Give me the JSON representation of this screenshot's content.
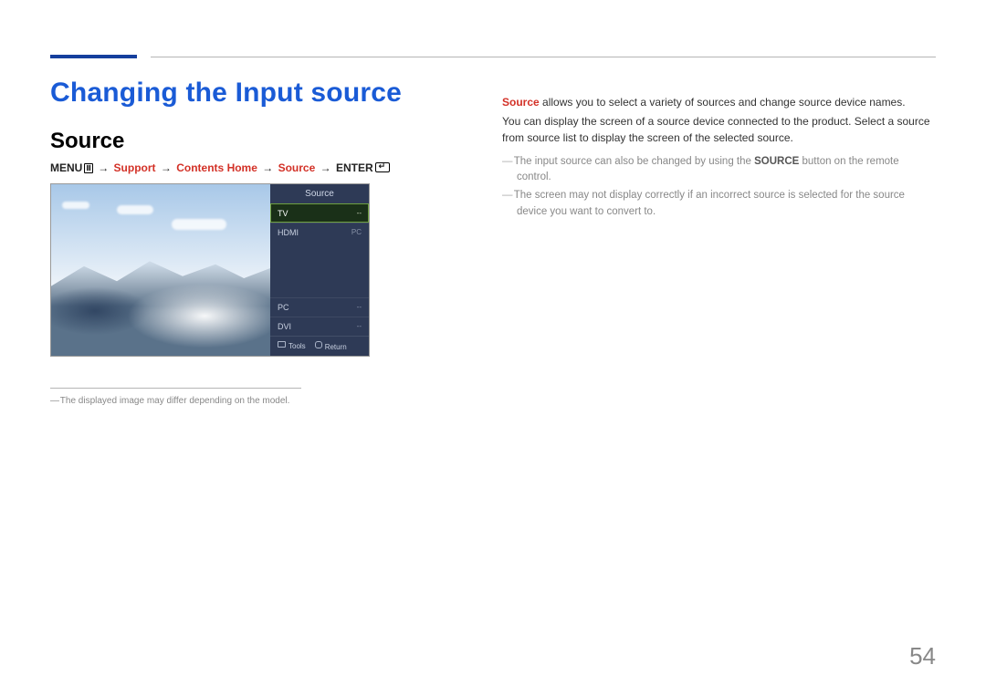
{
  "page_number": "54",
  "header": {
    "title": "Changing the Input source",
    "subtitle": "Source"
  },
  "nav_path": {
    "menu": "MENU",
    "step1": "Support",
    "step2": "Contents Home",
    "step3": "Source",
    "enter": "ENTER"
  },
  "osd": {
    "title": "Source",
    "items": [
      {
        "label": "TV",
        "value": "--",
        "selected": true
      },
      {
        "label": "HDMI",
        "value": "PC",
        "selected": false
      },
      {
        "label": "PC",
        "value": "--",
        "selected": false
      },
      {
        "label": "DVI",
        "value": "--",
        "selected": false
      }
    ],
    "bottom": {
      "tools": "Tools",
      "return": "Return"
    }
  },
  "left_note": "The displayed image may differ depending on the model.",
  "body": {
    "p1_lead": "Source",
    "p1_rest": " allows you to select a variety of sources and change source device names.",
    "p2": "You can display the screen of a source device connected to the product. Select a source from source list to display the screen of the selected source.",
    "bullets": [
      {
        "pre": "The input source can also be changed by using the ",
        "bold": "SOURCE",
        "post": " button on the remote control."
      },
      {
        "pre": "The screen may not display correctly if an incorrect source is selected for the source device you want to convert to.",
        "bold": "",
        "post": ""
      }
    ]
  }
}
